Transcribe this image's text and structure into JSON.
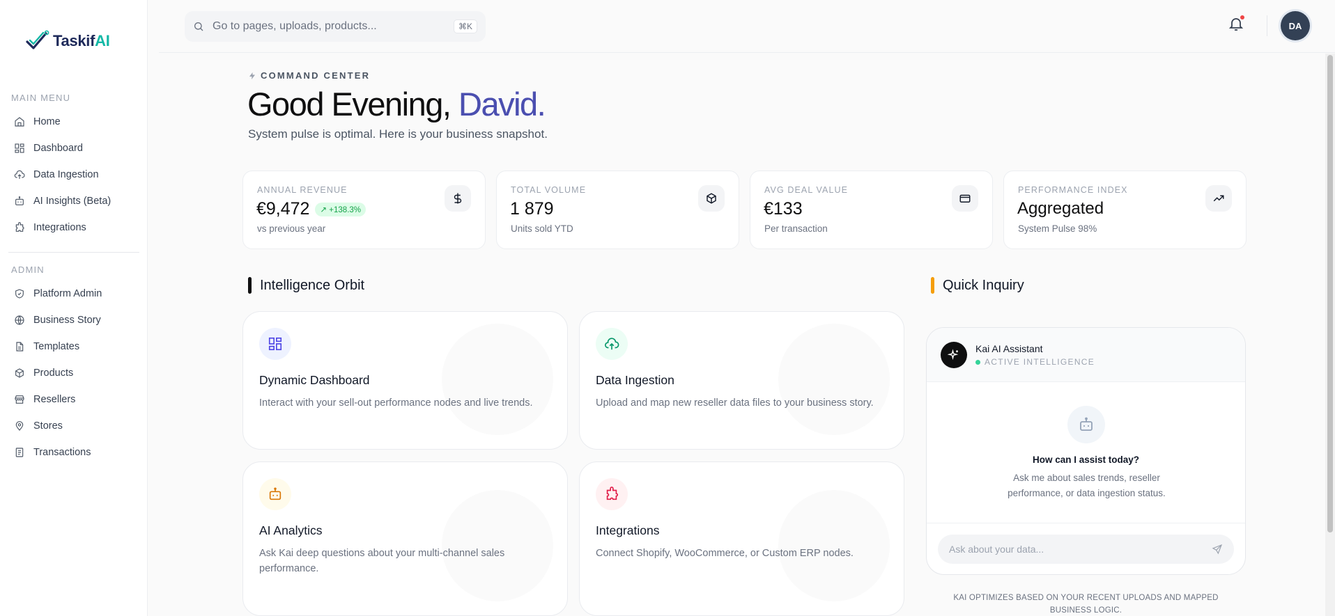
{
  "brand": {
    "name_main": "Taskif",
    "name_accent": "AI",
    "accent_color": "#14b8a6"
  },
  "sidebar": {
    "main_label": "MAIN MENU",
    "main_items": [
      {
        "label": "Home",
        "icon": "home-icon"
      },
      {
        "label": "Dashboard",
        "icon": "dashboard-icon"
      },
      {
        "label": "Data Ingestion",
        "icon": "upload-cloud-icon"
      },
      {
        "label": "AI Insights (Beta)",
        "icon": "bot-icon"
      },
      {
        "label": "Integrations",
        "icon": "puzzle-icon"
      }
    ],
    "admin_label": "ADMIN",
    "admin_items": [
      {
        "label": "Platform Admin",
        "icon": "shield-icon"
      },
      {
        "label": "Business Story",
        "icon": "globe-icon"
      },
      {
        "label": "Templates",
        "icon": "file-icon"
      },
      {
        "label": "Products",
        "icon": "box-icon"
      },
      {
        "label": "Resellers",
        "icon": "store-icon"
      },
      {
        "label": "Stores",
        "icon": "map-pin-icon"
      },
      {
        "label": "Transactions",
        "icon": "receipt-icon"
      }
    ]
  },
  "topbar": {
    "search_placeholder": "Go to pages, uploads, products...",
    "shortcut": "⌘K",
    "avatar_initials": "DA"
  },
  "header": {
    "eyebrow": "COMMAND CENTER",
    "greeting": "Good Evening, ",
    "name": "David.",
    "subtitle": "System pulse is optimal. Here is your business snapshot."
  },
  "kpis": [
    {
      "label": "ANNUAL REVENUE",
      "value": "€9,472",
      "badge": "↗ +138.3%",
      "sub": "vs previous year",
      "icon": "dollar-icon"
    },
    {
      "label": "TOTAL VOLUME",
      "value": "1 879",
      "sub": "Units sold YTD",
      "icon": "box-icon"
    },
    {
      "label": "AVG DEAL VALUE",
      "value": "€133",
      "sub": "Per transaction",
      "icon": "credit-card-icon"
    },
    {
      "label": "PERFORMANCE INDEX",
      "value": "Aggregated",
      "sub": "System Pulse 98%",
      "icon": "trending-up-icon"
    }
  ],
  "orbit": {
    "title": "Intelligence Orbit",
    "bar_color": "#0f0f10",
    "cards": [
      {
        "title": "Dynamic Dashboard",
        "desc": "Interact with your sell-out performance nodes and live trends.",
        "icon": "dashboard-icon",
        "icon_color": "#4f46e5",
        "icon_bg": "#eef2ff"
      },
      {
        "title": "Data Ingestion",
        "desc": "Upload and map new reseller data files to your business story.",
        "icon": "upload-cloud-icon",
        "icon_color": "#059669",
        "icon_bg": "#ecfdf5"
      },
      {
        "title": "AI Analytics",
        "desc": "Ask Kai deep questions about your multi-channel sales performance.",
        "icon": "bot-icon",
        "icon_color": "#d97706",
        "icon_bg": "#fffbeb"
      },
      {
        "title": "Integrations",
        "desc": "Connect Shopify, WooCommerce, or Custom ERP nodes.",
        "icon": "puzzle-icon",
        "icon_color": "#e11d48",
        "icon_bg": "#fff1f2"
      }
    ]
  },
  "inquiry": {
    "title": "Quick Inquiry",
    "bar_color": "#f59e0b",
    "assistant_name": "Kai AI Assistant",
    "status": "ACTIVE INTELLIGENCE",
    "question": "How can I assist today?",
    "hint": "Ask me about sales trends, reseller performance, or data ingestion status.",
    "input_placeholder": "Ask about your data...",
    "note": "KAI OPTIMIZES BASED ON YOUR RECENT UPLOADS AND MAPPED BUSINESS LOGIC."
  }
}
